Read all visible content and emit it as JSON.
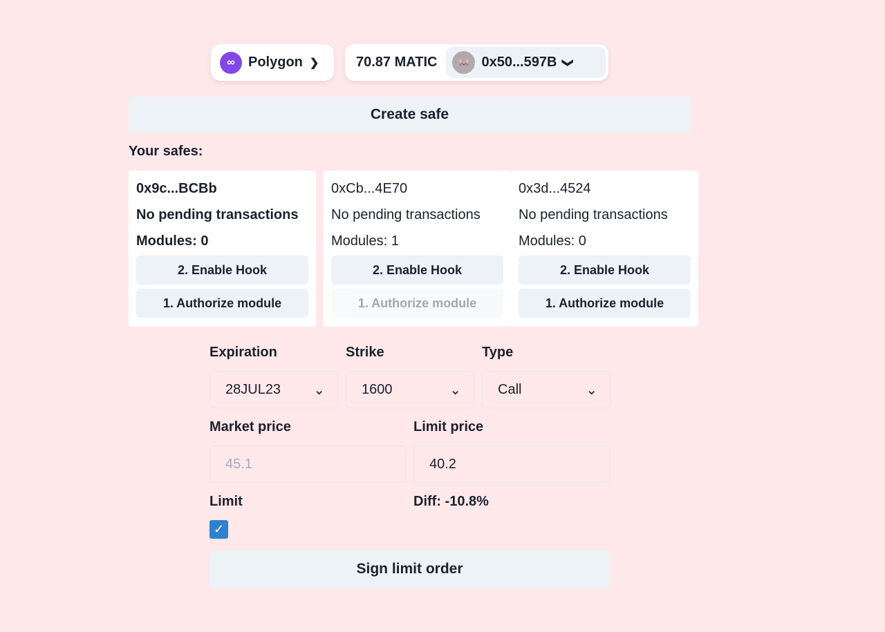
{
  "header": {
    "network": "Polygon",
    "balance": "70.87 MATIC",
    "account": "0x50...597B"
  },
  "create_safe": "Create safe",
  "safes_label": "Your safes:",
  "safes": [
    {
      "address": "0x9c...BCBb",
      "status": "No pending transactions",
      "modules": "Modules: 0",
      "enable_hook": "2. Enable Hook",
      "authorize": "1. Authorize module",
      "authorize_disabled": false,
      "bold": true
    },
    {
      "address": "0xCb...4E70",
      "status": "No pending transactions",
      "modules": "Modules: 1",
      "enable_hook": "2. Enable Hook",
      "authorize": "1. Authorize module",
      "authorize_disabled": true,
      "bold": false
    },
    {
      "address": "0x3d...4524",
      "status": "No pending transactions",
      "modules": "Modules: 0",
      "enable_hook": "2. Enable Hook",
      "authorize": "1. Authorize module",
      "authorize_disabled": false,
      "bold": false
    }
  ],
  "form": {
    "expiration_label": "Expiration",
    "expiration": "28JUL23",
    "strike_label": "Strike",
    "strike": "1600",
    "type_label": "Type",
    "type": "Call",
    "market_label": "Market price",
    "market": "45.1",
    "limit_price_label": "Limit price",
    "limit_price": "40.2",
    "limit_label": "Limit",
    "limit_checked": true,
    "diff": "Diff: -10.8%",
    "sign": "Sign limit order"
  },
  "colors": {
    "background": "#fee8ea",
    "polygon": "#8247e5",
    "checkbox": "#3182ce"
  }
}
